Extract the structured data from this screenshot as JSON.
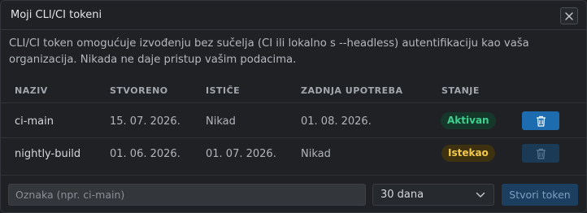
{
  "dialog": {
    "title": "Moji CLI/CI tokeni",
    "description": "CLI/CI token omogućuje izvođenju bez sučelja (CI ili lokalno s --headless) autentifikaciju kao vaša organizacija. Nikada ne daje pristup vašim podacima."
  },
  "table": {
    "headers": {
      "name": "NAZIV",
      "created": "STVORENO",
      "expires": "ISTIČE",
      "last_used": "ZADNJA UPOTREBA",
      "status": "STANJE"
    },
    "rows": [
      {
        "name": "ci-main",
        "created": "15. 07. 2026.",
        "expires": "Nikad",
        "last_used": "01. 08. 2026.",
        "status": "Aktivan",
        "delete_enabled": true
      },
      {
        "name": "nightly-build",
        "created": "01. 06. 2026.",
        "expires": "01. 07. 2026.",
        "last_used": "Nikad",
        "status": "Istekao",
        "delete_enabled": false
      }
    ]
  },
  "footer": {
    "label_input": {
      "placeholder": "Oznaka (npr. ci-main)",
      "value": ""
    },
    "duration_select": {
      "value": "30 dana"
    },
    "create_label": "Stvori token"
  },
  "colors": {
    "accent": "#1e6cb0",
    "active_badge_text": "#3fcf8e",
    "expired_badge_text": "#f2c94c"
  },
  "icons": {
    "close": "close-icon",
    "delete": "trash-icon",
    "dropdown": "chevron-down-icon"
  }
}
